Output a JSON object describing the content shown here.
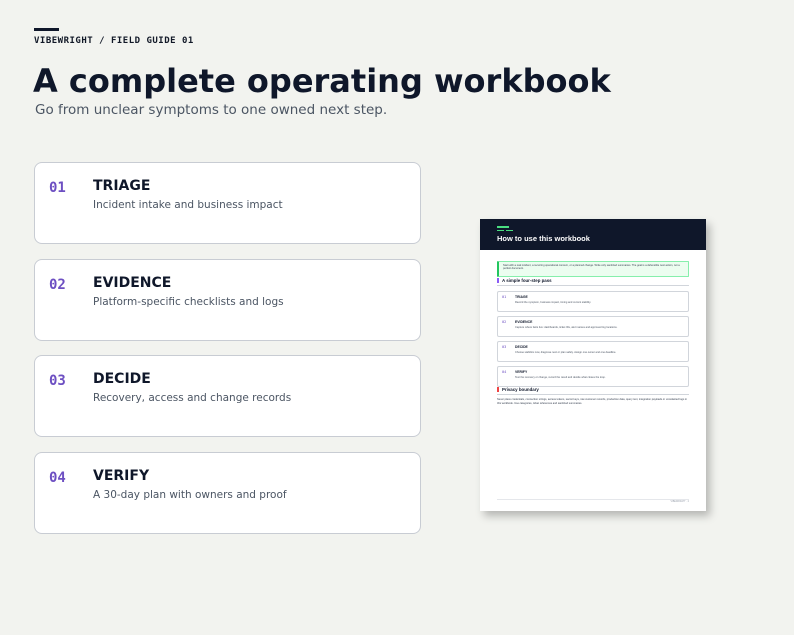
{
  "eyebrow": "VIBEWRIGHT / FIELD GUIDE 01",
  "title": "A complete operating workbook",
  "subtitle": "Go from unclear symptoms to one owned next step.",
  "cards": [
    {
      "num": "01",
      "label": "TRIAGE",
      "desc": "Incident intake and business impact"
    },
    {
      "num": "02",
      "label": "EVIDENCE",
      "desc": "Platform-specific checklists and logs"
    },
    {
      "num": "03",
      "label": "DECIDE",
      "desc": "Recovery, access and change records"
    },
    {
      "num": "04",
      "label": "VERIFY",
      "desc": "A 30-day plan with owners and proof"
    }
  ],
  "preview": {
    "title": "How to use this workbook",
    "note": "Start with a real incident, a recurring operational concern, or a planned change. Write only sanitized summaries. The goal is a defensible next action, not a perfect document.",
    "section1": "A simple four-step pass",
    "steps": [
      {
        "num": "01",
        "label": "TRIAGE",
        "desc": "Record the symptom, business impact, timing and current stability."
      },
      {
        "num": "02",
        "label": "EVIDENCE",
        "desc": "Capture where facts live: dashboards, ticket IDs, alert names and approved log locations."
      },
      {
        "num": "03",
        "label": "DECIDE",
        "desc": "Choose stabilize now, diagnose next or plan safely. Assign one owner and one deadline."
      },
      {
        "num": "04",
        "label": "VERIFY",
        "desc": "Test the recovery or change, record the result and decide what closes the loop."
      }
    ],
    "section2": "Privacy boundary",
    "privacy": "Never place credentials, connection strings, access tokens, secret keys, raw customer records, production data, query text, integration payloads or unredacted logs in this workbook. Use categories, ticket references and sanitized summaries.",
    "footer": "VIBEWRIGHT · 2"
  },
  "colors": {
    "accent_number": "#6d4fc2",
    "dark": "#0f172a",
    "green": "#22c55e",
    "privacy_red": "#ef4444",
    "background": "#f2f3ef"
  }
}
